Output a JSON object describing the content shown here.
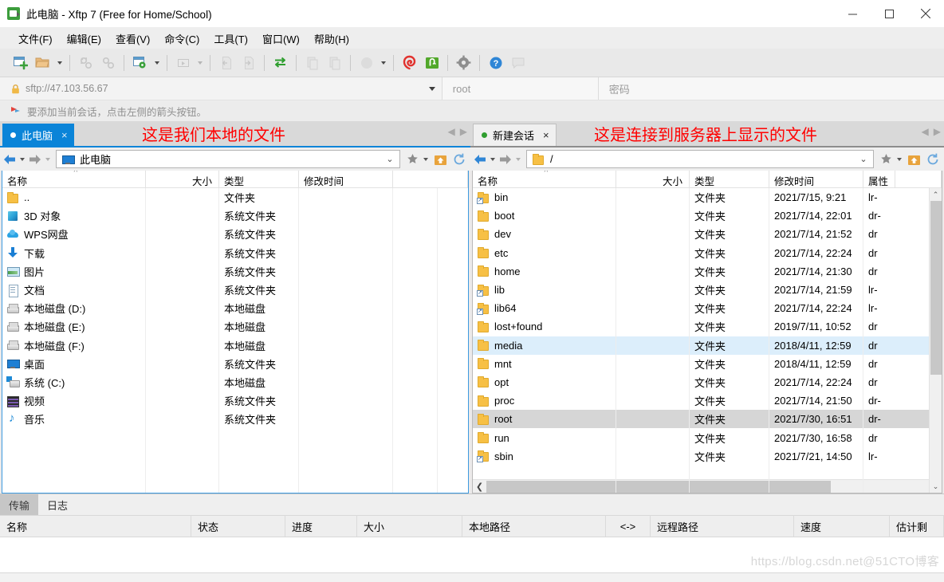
{
  "window": {
    "title": "此电脑 - Xftp 7 (Free for Home/School)",
    "app_icon": "xftp-icon",
    "minimize_label": "最小化",
    "maximize_label": "最大化",
    "close_label": "关闭"
  },
  "menubar": [
    {
      "label": "文件(F)",
      "name": "menu-file"
    },
    {
      "label": "编辑(E)",
      "name": "menu-edit"
    },
    {
      "label": "查看(V)",
      "name": "menu-view"
    },
    {
      "label": "命令(C)",
      "name": "menu-command"
    },
    {
      "label": "工具(T)",
      "name": "menu-tools"
    },
    {
      "label": "窗口(W)",
      "name": "menu-window"
    },
    {
      "label": "帮助(H)",
      "name": "menu-help"
    }
  ],
  "toolbar": {
    "buttons": [
      {
        "name": "new-session-button",
        "icon": "new-window-plus-icon",
        "enabled": true
      },
      {
        "name": "open-folder-button",
        "icon": "open-folder-icon",
        "enabled": true,
        "caret": true
      },
      {
        "name": "disconnect-button",
        "icon": "broken-link-icon",
        "enabled": false
      },
      {
        "name": "connect-button",
        "icon": "link-icon",
        "enabled": false
      },
      {
        "name": "session-settings-button",
        "icon": "window-gear-icon",
        "enabled": true,
        "caret": true
      },
      {
        "name": "run-button",
        "icon": "play-box-icon",
        "enabled": false,
        "caret": true
      },
      {
        "name": "transfer-left-button",
        "icon": "file-left-arrow-icon",
        "enabled": false
      },
      {
        "name": "transfer-right-button",
        "icon": "file-right-arrow-icon",
        "enabled": false
      },
      {
        "name": "sync-browsing-button",
        "icon": "two-way-arrows-icon",
        "enabled": true
      },
      {
        "name": "copy-button",
        "icon": "copy-icon",
        "enabled": false
      },
      {
        "name": "paste-button",
        "icon": "paste-icon",
        "enabled": false
      },
      {
        "name": "transfer-mode-button",
        "icon": "circle-icon",
        "enabled": false,
        "caret": true
      },
      {
        "name": "xshell-button",
        "icon": "xshell-spiral-icon",
        "enabled": true
      },
      {
        "name": "xftp-button",
        "icon": "xftp-green-icon",
        "enabled": true
      },
      {
        "name": "options-button",
        "icon": "gear-icon",
        "enabled": true
      },
      {
        "name": "help-button",
        "icon": "question-circle-icon",
        "enabled": true
      },
      {
        "name": "feedback-button",
        "icon": "speech-bubble-icon",
        "enabled": false
      }
    ]
  },
  "addressbar": {
    "lock_icon": "lock-icon",
    "url": "sftp://47.103.56.67",
    "dropdown_icon": "chevron-down-icon",
    "username_placeholder": "root",
    "password_placeholder": "密码"
  },
  "hintbar": {
    "icon": "red-flag-icon",
    "text": "要添加当前会话，点击左侧的箭头按钮。"
  },
  "left_pane": {
    "annotation": "这是我们本地的文件",
    "tab": {
      "label": "此电脑",
      "dot_color": "#ffffff",
      "close_label": "×"
    },
    "tabnav": {
      "prev": "◀",
      "next": "▶"
    },
    "nav": {
      "back_label": "后退",
      "forward_label": "前进",
      "path_icon": "this-pc-icon",
      "path": "此电脑",
      "chevron": "⌄",
      "favorites_icon": "star-icon",
      "home_icon": "home-icon",
      "refresh_icon": "refresh-icon"
    },
    "columns": [
      "名称",
      "大小",
      "类型",
      "修改时间"
    ],
    "rows": [
      {
        "name": "..",
        "icon": "folder-icon",
        "size": "",
        "type": "文件夹",
        "time": ""
      },
      {
        "name": "3D 对象",
        "icon": "3d-objects-icon",
        "size": "",
        "type": "系统文件夹",
        "time": ""
      },
      {
        "name": "WPS网盘",
        "icon": "cloud-icon",
        "size": "",
        "type": "系统文件夹",
        "time": ""
      },
      {
        "name": "下载",
        "icon": "download-icon",
        "size": "",
        "type": "系统文件夹",
        "time": ""
      },
      {
        "name": "图片",
        "icon": "picture-icon",
        "size": "",
        "type": "系统文件夹",
        "time": ""
      },
      {
        "name": "文档",
        "icon": "document-icon",
        "size": "",
        "type": "系统文件夹",
        "time": ""
      },
      {
        "name": "本地磁盘 (D:)",
        "icon": "drive-icon",
        "size": "",
        "type": "本地磁盘",
        "time": ""
      },
      {
        "name": "本地磁盘 (E:)",
        "icon": "drive-icon",
        "size": "",
        "type": "本地磁盘",
        "time": ""
      },
      {
        "name": "本地磁盘 (F:)",
        "icon": "drive-icon",
        "size": "",
        "type": "本地磁盘",
        "time": ""
      },
      {
        "name": "桌面",
        "icon": "desktop-icon",
        "size": "",
        "type": "系统文件夹",
        "time": ""
      },
      {
        "name": "系统 (C:)",
        "icon": "system-drive-icon",
        "size": "",
        "type": "本地磁盘",
        "time": ""
      },
      {
        "name": "视频",
        "icon": "video-icon",
        "size": "",
        "type": "系统文件夹",
        "time": ""
      },
      {
        "name": "音乐",
        "icon": "music-icon",
        "size": "",
        "type": "系统文件夹",
        "time": ""
      }
    ]
  },
  "right_pane": {
    "annotation": "这是连接到服务器上显示的文件",
    "tab": {
      "label": "新建会话",
      "dot_color": "#2f9e2f",
      "close_label": "×"
    },
    "tabnav": {
      "prev": "◀",
      "next": "▶"
    },
    "nav": {
      "back_label": "后退",
      "forward_label": "前进",
      "path_icon": "folder-icon",
      "path": "/",
      "chevron": "⌄",
      "favorites_icon": "star-icon",
      "home_icon": "home-icon",
      "refresh_icon": "refresh-icon"
    },
    "columns": [
      "名称",
      "大小",
      "类型",
      "修改时间",
      "属性"
    ],
    "rows": [
      {
        "name": "bin",
        "icon": "folder-link-icon",
        "size": "",
        "type": "文件夹",
        "time": "2021/7/15, 9:21",
        "attr": "lr-",
        "state": ""
      },
      {
        "name": "boot",
        "icon": "folder-icon",
        "size": "",
        "type": "文件夹",
        "time": "2021/7/14, 22:01",
        "attr": "dr-",
        "state": ""
      },
      {
        "name": "dev",
        "icon": "folder-icon",
        "size": "",
        "type": "文件夹",
        "time": "2021/7/14, 21:52",
        "attr": "dr",
        "state": ""
      },
      {
        "name": "etc",
        "icon": "folder-icon",
        "size": "",
        "type": "文件夹",
        "time": "2021/7/14, 22:24",
        "attr": "dr",
        "state": ""
      },
      {
        "name": "home",
        "icon": "folder-icon",
        "size": "",
        "type": "文件夹",
        "time": "2021/7/14, 21:30",
        "attr": "dr",
        "state": ""
      },
      {
        "name": "lib",
        "icon": "folder-link-icon",
        "size": "",
        "type": "文件夹",
        "time": "2021/7/14, 21:59",
        "attr": "lr-",
        "state": ""
      },
      {
        "name": "lib64",
        "icon": "folder-link-icon",
        "size": "",
        "type": "文件夹",
        "time": "2021/7/14, 22:24",
        "attr": "lr-",
        "state": ""
      },
      {
        "name": "lost+found",
        "icon": "folder-icon",
        "size": "",
        "type": "文件夹",
        "time": "2019/7/11, 10:52",
        "attr": "dr",
        "state": ""
      },
      {
        "name": "media",
        "icon": "folder-icon",
        "size": "",
        "type": "文件夹",
        "time": "2018/4/11, 12:59",
        "attr": "dr",
        "state": "hover"
      },
      {
        "name": "mnt",
        "icon": "folder-icon",
        "size": "",
        "type": "文件夹",
        "time": "2018/4/11, 12:59",
        "attr": "dr",
        "state": ""
      },
      {
        "name": "opt",
        "icon": "folder-icon",
        "size": "",
        "type": "文件夹",
        "time": "2021/7/14, 22:24",
        "attr": "dr",
        "state": ""
      },
      {
        "name": "proc",
        "icon": "folder-icon",
        "size": "",
        "type": "文件夹",
        "time": "2021/7/14, 21:50",
        "attr": "dr-",
        "state": ""
      },
      {
        "name": "root",
        "icon": "folder-icon",
        "size": "",
        "type": "文件夹",
        "time": "2021/7/30, 16:51",
        "attr": "dr-",
        "state": "selected"
      },
      {
        "name": "run",
        "icon": "folder-icon",
        "size": "",
        "type": "文件夹",
        "time": "2021/7/30, 16:58",
        "attr": "dr",
        "state": ""
      },
      {
        "name": "sbin",
        "icon": "folder-link-icon",
        "size": "",
        "type": "文件夹",
        "time": "2021/7/21, 14:50",
        "attr": "lr-",
        "state": ""
      }
    ]
  },
  "bottom": {
    "tabs": [
      {
        "label": "传输",
        "name": "tab-transfer",
        "selected": true
      },
      {
        "label": "日志",
        "name": "tab-log",
        "selected": false
      }
    ],
    "columns": [
      {
        "label": "名称",
        "name": "col-name"
      },
      {
        "label": "状态",
        "name": "col-status"
      },
      {
        "label": "进度",
        "name": "col-progress"
      },
      {
        "label": "大小",
        "name": "col-size"
      },
      {
        "label": "本地路径",
        "name": "col-local-path"
      },
      {
        "label": "<->",
        "name": "col-direction"
      },
      {
        "label": "远程路径",
        "name": "col-remote-path"
      },
      {
        "label": "速度",
        "name": "col-speed"
      },
      {
        "label": "估计剩",
        "name": "col-eta"
      }
    ],
    "watermark": "https://blog.csdn.net@51CTO博客"
  }
}
